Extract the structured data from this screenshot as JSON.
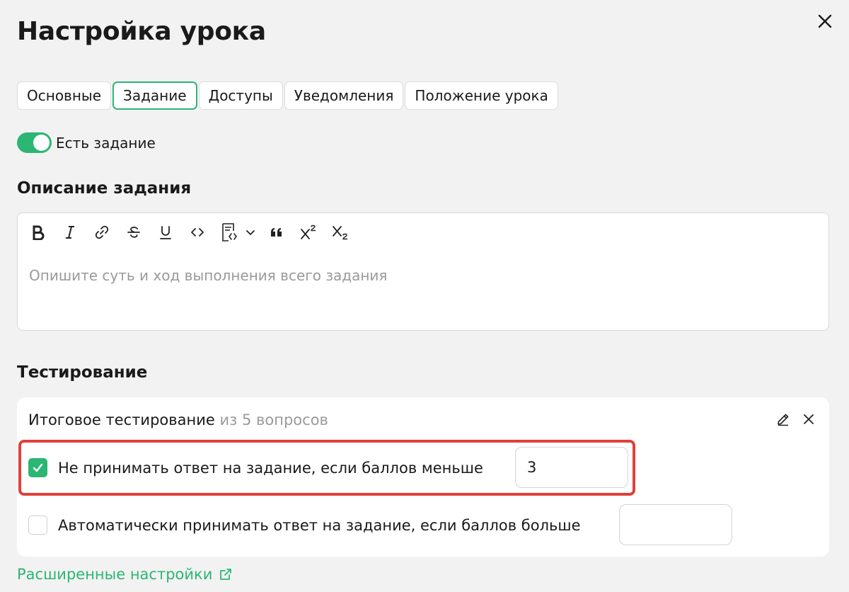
{
  "dialog": {
    "title": "Настройка урока"
  },
  "tabs": [
    {
      "label": "Основные",
      "active": false
    },
    {
      "label": "Задание",
      "active": true
    },
    {
      "label": "Доступы",
      "active": false
    },
    {
      "label": "Уведомления",
      "active": false
    },
    {
      "label": "Положение урока",
      "active": false
    }
  ],
  "task_toggle": {
    "label": "Есть задание",
    "on": true
  },
  "description": {
    "heading": "Описание задания",
    "placeholder": "Опишите суть и ход выполнения всего задания",
    "toolbar": [
      "bold-icon",
      "italic-icon",
      "link-icon",
      "strikethrough-icon",
      "underline-icon",
      "code-icon",
      "code-block-icon",
      "quote-icon",
      "superscript-icon",
      "subscript-icon"
    ]
  },
  "testing": {
    "heading": "Тестирование",
    "test_name": "Итоговое тестирование",
    "questions_note": "из 5 вопросов",
    "reject_rule": {
      "checked": true,
      "label": "Не принимать ответ на задание, если баллов меньше",
      "value": "3"
    },
    "accept_rule": {
      "checked": false,
      "label": "Автоматически принимать ответ на задание, если баллов больше",
      "value": ""
    }
  },
  "advanced_link": {
    "label": "Расширенные настройки"
  },
  "colors": {
    "accent": "#2bb673",
    "highlight": "#e0403a",
    "background": "#f2f2f2"
  }
}
